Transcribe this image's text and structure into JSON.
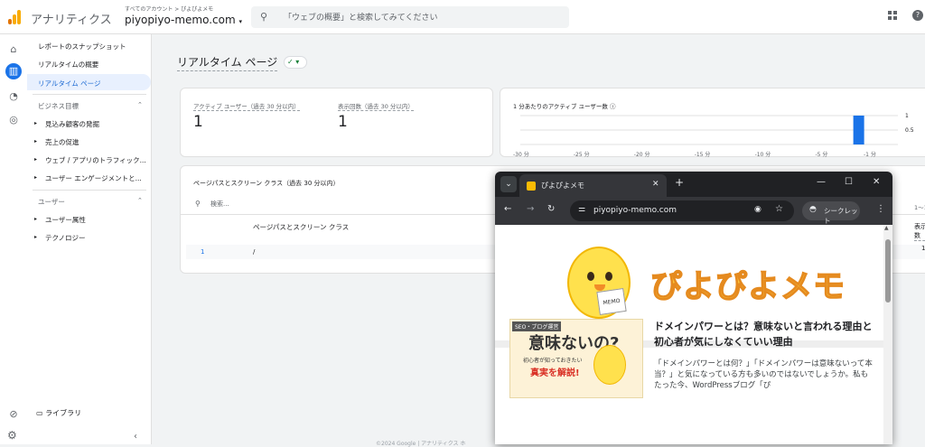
{
  "header": {
    "app_title": "アナリティクス",
    "account_crumb": "すべてのアカウント > ぴよぴよメモ",
    "property_name": "piyopiyo-memo.com",
    "property_dropdown": "▾",
    "search_placeholder": "「ウェブの概要」と検索してみてください",
    "help_glyph": "?"
  },
  "sidebar": {
    "items": [
      {
        "label": "レポートのスナップショット"
      },
      {
        "label": "リアルタイムの概要"
      },
      {
        "label": "リアルタイム ページ"
      }
    ],
    "section_business": "ビジネス目標",
    "business_items": [
      {
        "label": "見込み顧客の発掘"
      },
      {
        "label": "売上の促進"
      },
      {
        "label": "ウェブ / アプリのトラフィック..."
      },
      {
        "label": "ユーザー エンゲージメントと..."
      }
    ],
    "section_user": "ユーザー",
    "user_items": [
      {
        "label": "ユーザー属性"
      },
      {
        "label": "テクノロジー"
      }
    ],
    "library": "ライブラリ",
    "collapse": "‹",
    "chevron": "⌃",
    "caret": "▸"
  },
  "main": {
    "page_title": "リアルタイム ページ",
    "status_glyph": "✓ ▾",
    "metrics": [
      {
        "label": "アクティブ ユーザー（過去 30 分以内）",
        "value": "1"
      },
      {
        "label": "表示回数（過去 30 分以内）",
        "value": "1"
      }
    ],
    "users_chart": {
      "title": "1 分あたりのアクティブ ユーザー数 ⓘ"
    },
    "table": {
      "title": "ページパスとスクリーン クラス（過去 30 分以内）",
      "search_placeholder": "検索...",
      "column_header": "ページパスとスクリーン クラス",
      "row_index": "1",
      "row_path": "/",
      "pager": "1〜1/1",
      "views_header": "表示回数",
      "views_value": "1"
    },
    "footer": "©2024 Google | アナリティクス ホ"
  },
  "chart_data": {
    "type": "bar",
    "title": "1 分あたりのアクティブ ユーザー数",
    "x_ticks": [
      "-30 分",
      "-25 分",
      "-20 分",
      "-15 分",
      "-10 分",
      "-5 分",
      "-1 分"
    ],
    "y_ticks": [
      "1",
      "0.5"
    ],
    "ylim": [
      0,
      1
    ],
    "x_minutes": [
      -2
    ],
    "values": [
      1
    ],
    "grid": true,
    "bar_color": "#1a73e8"
  },
  "browser": {
    "tab_title": "ぴよぴよメモ",
    "tab_close": "✕",
    "new_tab": "+",
    "url": "piyopiyo-memo.com",
    "incognito_label": "シークレット",
    "window_min": "—",
    "window_max": "☐",
    "window_close": "✕",
    "site_logo_text": "ぴよぴよメモ",
    "memo_label": "MEMO",
    "thumb_badge": "SEO・ブログ運営",
    "thumb_big": "意味ないの?",
    "thumb_sub": "初心者が知っておきたい",
    "thumb_red": "真実を解説!",
    "post_title": "ドメインパワーとは？意味ないと言われる理由と初心者が気にしなくていい理由",
    "post_excerpt": "「ドメインパワーとは何？」「ドメインパワーは意味ないって本当？」と気になっている方も多いのではないでしょうか。私もたった今、WordPressブログ「ぴ"
  }
}
